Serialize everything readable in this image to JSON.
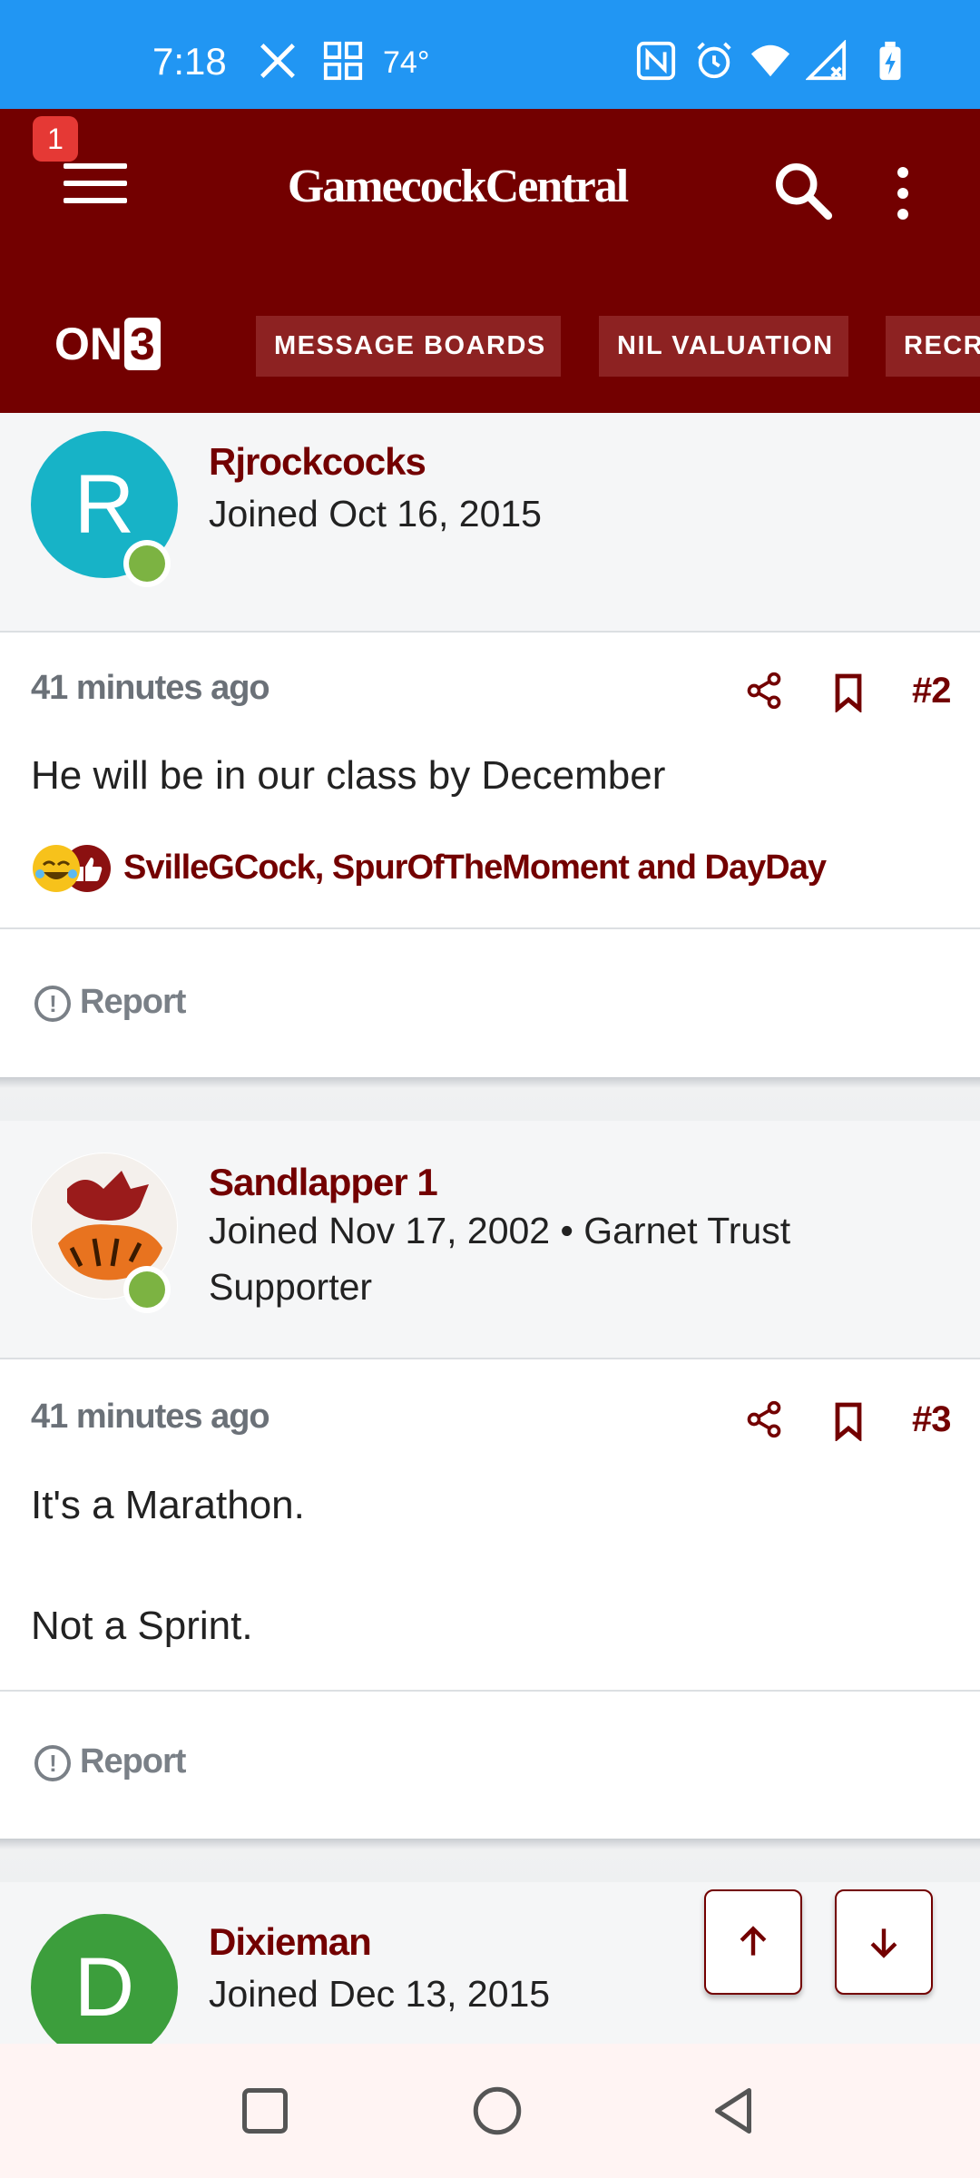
{
  "status_bar": {
    "time": "7:18",
    "temperature": "74°",
    "icons": [
      "x-logo-icon",
      "qr-widget-icon",
      "nfc-icon",
      "alarm-icon",
      "wifi-icon",
      "signal-icon",
      "battery-charging-icon"
    ]
  },
  "header": {
    "notification_count": "1",
    "brand": "GamecockCentral",
    "on3_logo_text": "ON",
    "on3_logo_digit": "3",
    "nav_tabs": [
      "MESSAGE BOARDS",
      "NIL VALUATION",
      "RECRUITING"
    ]
  },
  "posts": [
    {
      "author": "Rjrockcocks",
      "avatar_letter": "R",
      "joined": "Joined Oct 16, 2015",
      "time_ago": "41 minutes ago",
      "post_number": "#2",
      "body": [
        "He will be in our class by December"
      ],
      "reactions": "SvilleGCock, SpurOfTheMoment and DayDay",
      "report_label": "Report"
    },
    {
      "author": "Sandlapper 1",
      "joined": "Joined Nov 17, 2002 • Garnet Trust Supporter",
      "time_ago": "41 minutes ago",
      "post_number": "#3",
      "body": [
        "It's a Marathon.",
        "Not a Sprint."
      ],
      "report_label": "Report"
    },
    {
      "author": "Dixieman",
      "avatar_letter": "D",
      "joined": "Joined Dec 13, 2015"
    }
  ],
  "colors": {
    "brand_garnet": "#730000",
    "status_bar": "#2196f3",
    "avatar_teal": "#17b3c7",
    "avatar_green": "#3c9e3c",
    "online_green": "#7cb342"
  }
}
